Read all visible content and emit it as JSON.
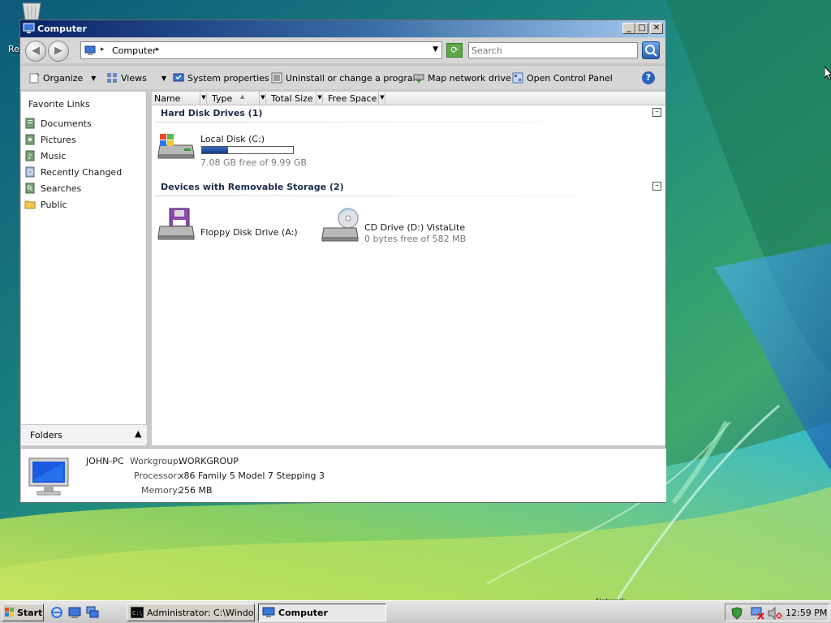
{
  "desktop": {
    "recycle_label": "Re"
  },
  "window": {
    "title": "Computer",
    "minimize": "_",
    "maximize": "□",
    "close": "✕"
  },
  "address_bar": {
    "location": "Computer",
    "search_placeholder": "Search"
  },
  "command_bar": {
    "organize": "Organize",
    "views": "Views",
    "system_properties": "System properties",
    "uninstall": "Uninstall or change a program",
    "map_drive": "Map network drive",
    "control_panel": "Open Control Panel",
    "help": "?"
  },
  "nav_pane": {
    "header": "Favorite Links",
    "items": [
      {
        "label": "Documents",
        "icon": "documents-icon"
      },
      {
        "label": "Pictures",
        "icon": "pictures-icon"
      },
      {
        "label": "Music",
        "icon": "music-icon"
      },
      {
        "label": "Recently Changed",
        "icon": "recently-changed-icon"
      },
      {
        "label": "Searches",
        "icon": "searches-icon"
      },
      {
        "label": "Public",
        "icon": "public-folder-icon"
      }
    ],
    "folders_label": "Folders"
  },
  "columns": [
    "Name",
    "Type",
    "Total Size",
    "Free Space"
  ],
  "groups": {
    "hard_disks": {
      "header": "Hard Disk Drives (1)",
      "drives": [
        {
          "name": "Local Disk (C:)",
          "free_text": "7.08 GB free of 9.99 GB",
          "used_fraction": 0.29
        }
      ]
    },
    "removable": {
      "header": "Devices with Removable Storage (2)",
      "drives": [
        {
          "name": "Floppy Disk Drive (A:)"
        },
        {
          "name": "CD Drive (D:) VistaLite",
          "free_text": "0 bytes free of 582 MB"
        }
      ]
    }
  },
  "details": {
    "computer_name": "JOHN-PC",
    "workgroup_label": "Workgroup:",
    "workgroup": "WORKGROUP",
    "processor_label": "Processor:",
    "processor": "x86 Family 5 Model 7 Stepping 3",
    "memory_label": "Memory:",
    "memory": "256 MB"
  },
  "taskbar": {
    "start": "Start",
    "tasks": [
      {
        "label": "Administrator: C:\\Windo..."
      },
      {
        "label": "Computer"
      }
    ],
    "network_label": "Network",
    "clock": "12:59 PM"
  },
  "colors": {
    "title_gradient_start": "#0a246a",
    "title_gradient_end": "#a6caf0",
    "capacity_fill": "#1e4a9c",
    "accent_green": "#5fa84a"
  }
}
